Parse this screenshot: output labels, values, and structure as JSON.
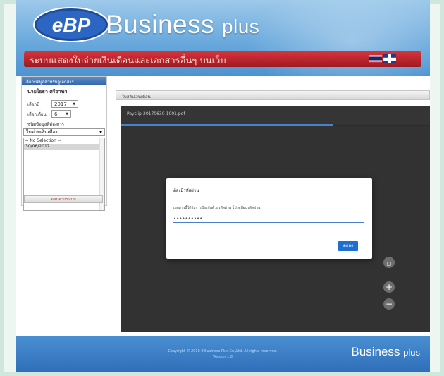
{
  "brand": {
    "title": "Business",
    "plus": "plus",
    "logo_text": "eBP",
    "subtitle": "ระบบแสดงใบจ่ายเงินเดือนและเอกสารอื่นๆ บนเว็บ"
  },
  "sidebar": {
    "header": "เลือกข้อมูลสำหรับดูเอกสาร",
    "employee_name": "นายโยธา ศรีอาฟา",
    "year_label": "เลือกปี",
    "year_value": "2017",
    "month_label": "เลือกเดือน",
    "month_value": "6",
    "doc_type_label": "ชนิดข้อมูลที่ต้องการ",
    "doc_type_value": "ใบจ่ายเงินเดือน",
    "list_items": [
      "-- No Selection --",
      "30/06/2017"
    ],
    "logout_label": "ออกจากระบบ"
  },
  "breadcrumb": "ใบสลิปเงินเดือน",
  "viewer": {
    "filename": "Payslip-20170630-1001.pdf"
  },
  "dialog": {
    "title": "ต้องมีรหัสผ่าน",
    "message": "เอกสารนี้ได้รับการป้องกันด้วยรหัสผ่าน โปรดป้อนรหัสผ่าน",
    "password_value": "••••••••••",
    "ok_label": "ตกลง"
  },
  "footer": {
    "copyright": "Copyright © 2016 E-Business Plus Co.,Ltd. All rights reserved.",
    "version": "Version 1.0",
    "brand": "Business",
    "plus": "plus"
  },
  "colors": {
    "header_blue": "#6aa9dc",
    "red_bar": "#c12a32",
    "viewer_bg": "#323232",
    "button_blue": "#1f6fd0"
  }
}
